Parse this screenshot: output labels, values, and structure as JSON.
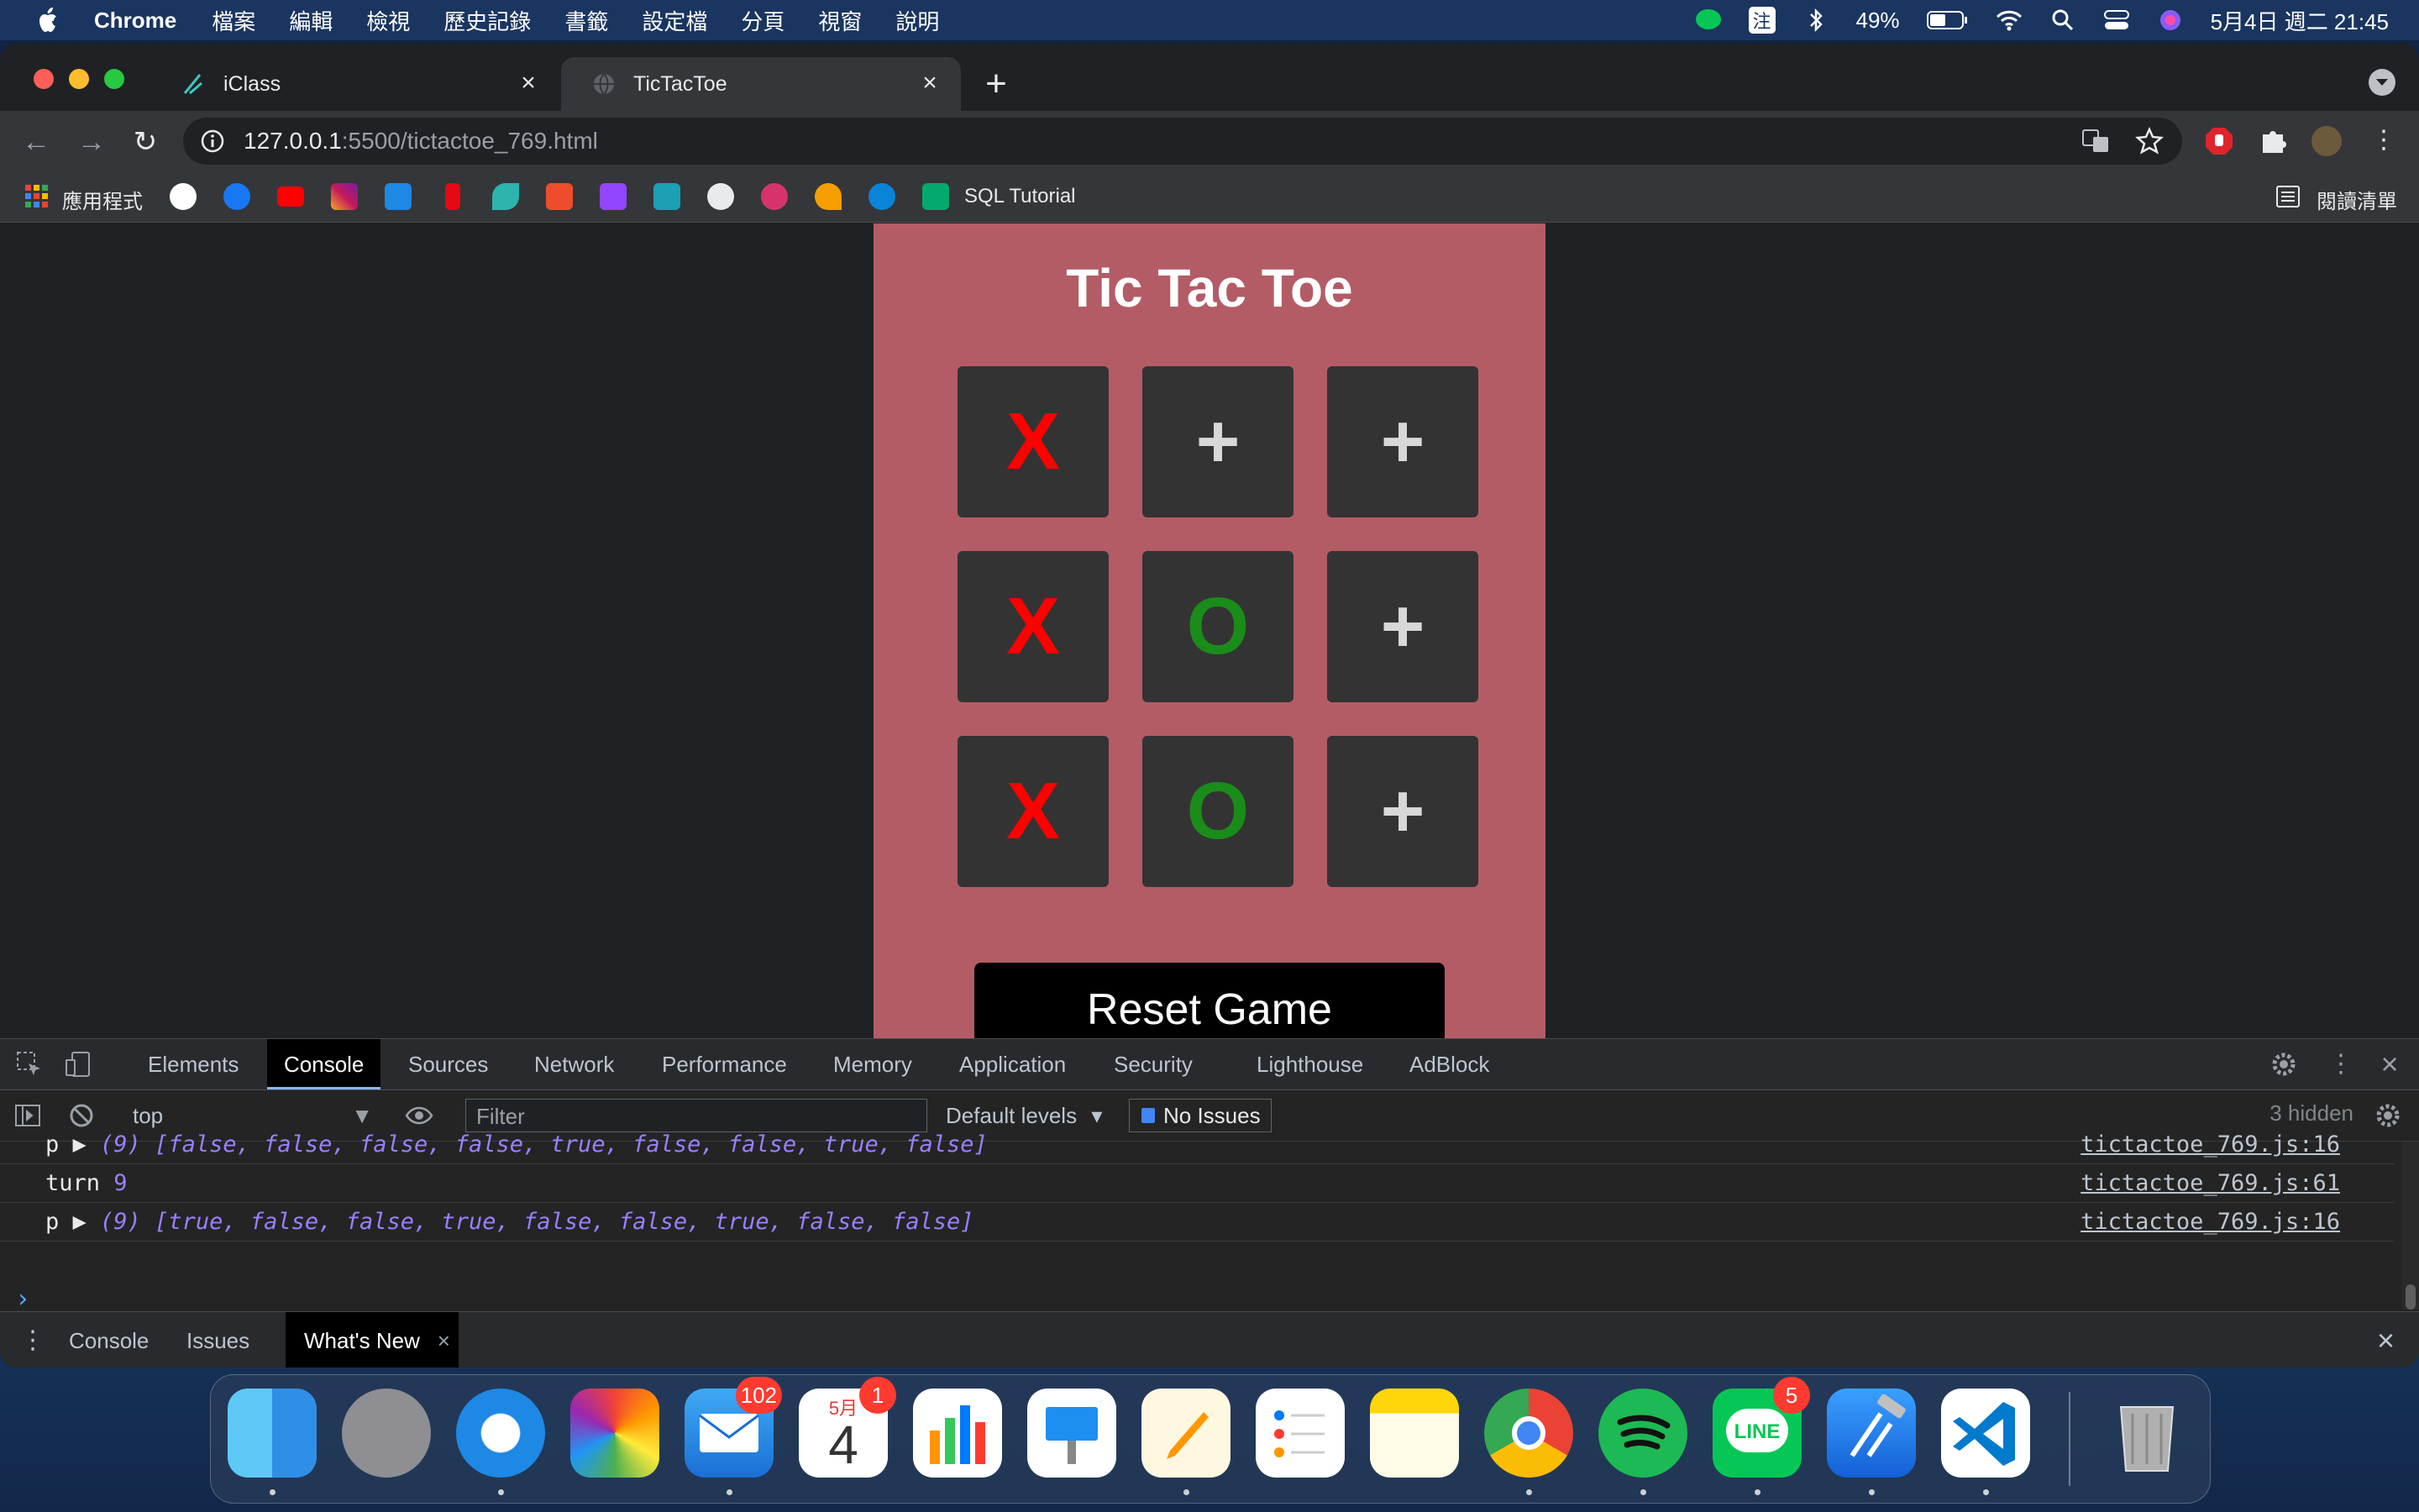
{
  "menubar": {
    "app_name": "Chrome",
    "menus": [
      "檔案",
      "編輯",
      "檢視",
      "歷史記錄",
      "書籤",
      "設定檔",
      "分頁",
      "視窗",
      "說明"
    ],
    "input_method": "注",
    "battery": "49%",
    "clock": "5月4日 週二  21:45"
  },
  "browser": {
    "tabs": [
      {
        "label": "iClass",
        "active": false
      },
      {
        "label": "TicTacToe",
        "active": true
      }
    ],
    "url_host": "127.0.0.1",
    "url_rest": ":5500/tictactoe_769.html",
    "bookmarks": {
      "apps_label": "應用程式",
      "sql_label": "SQL Tutorial",
      "reading_list_label": "閱讀清單"
    }
  },
  "game": {
    "title": "Tic Tac Toe",
    "board": [
      "X",
      "+",
      "+",
      "X",
      "O",
      "+",
      "X",
      "O",
      "+"
    ],
    "reset_label": "Reset Game"
  },
  "devtools": {
    "tabs": [
      "Elements",
      "Console",
      "Sources",
      "Network",
      "Performance",
      "Memory",
      "Application",
      "Security",
      "Lighthouse",
      "AdBlock"
    ],
    "active_tab": "Console",
    "context": "top",
    "filter_placeholder": "Filter",
    "levels": "Default levels",
    "issues": "No Issues",
    "hidden": "3 hidden",
    "logs": [
      {
        "prefix": "p ▶",
        "count": "(9)",
        "values": [
          "false",
          "false",
          "false",
          "false",
          "true",
          "false",
          "false",
          "true",
          "false"
        ],
        "source": "tictactoe_769.js:16"
      },
      {
        "prefix": "turn",
        "number": "9",
        "source": "tictactoe_769.js:61"
      },
      {
        "prefix": "p ▶",
        "count": "(9)",
        "values": [
          "true",
          "false",
          "false",
          "true",
          "false",
          "false",
          "true",
          "false",
          "false"
        ],
        "source": "tictactoe_769.js:16"
      }
    ],
    "drawer_tabs": [
      "Console",
      "Issues",
      "What's New"
    ]
  },
  "dock": {
    "mail_badge": "102",
    "calendar_month": "5月",
    "calendar_day": "4",
    "calendar_badge": "1",
    "line_badge": "5",
    "line_label": "LINE"
  },
  "colors": {
    "card": "#b35c66",
    "cell": "#333333",
    "x_mark": "#ff0000",
    "o_mark": "#1a8c1a"
  }
}
